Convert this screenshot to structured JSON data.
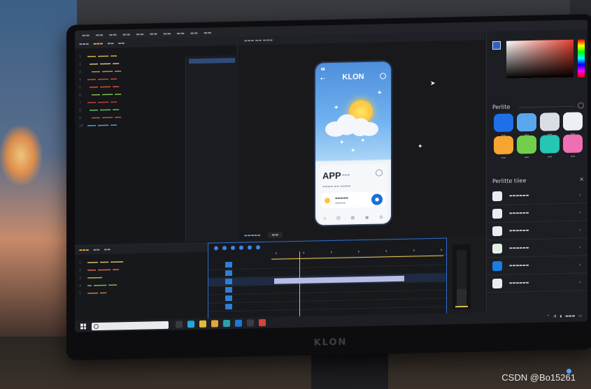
{
  "watermark": "CSDN @Bo15261",
  "monitor_brand": "KLON",
  "phone": {
    "title": "KLON",
    "card_title": "APP"
  },
  "palette": {
    "title": "Perlite",
    "swatches": [
      {
        "color": "#1f6fe8"
      },
      {
        "color": "#59a8ee"
      },
      {
        "color": "#d9dee6"
      },
      {
        "color": "#eceff3"
      },
      {
        "color": "#f7a531"
      },
      {
        "color": "#71cf4b"
      },
      {
        "color": "#25c6b4"
      },
      {
        "color": "#ef6fb4"
      }
    ]
  },
  "colors": {
    "accent": "#2d7be5",
    "timeline_border": "#2d6fd0",
    "highlight_yellow": "#e3c24b"
  },
  "properties": {
    "title": "Perlitte tiiee",
    "items": [
      {
        "thumb": "#e9ecf2",
        "icon": "chevron-right-icon"
      },
      {
        "thumb": "#e9ecf2",
        "icon": "chevron-right-icon"
      },
      {
        "thumb": "#e9ecf2",
        "icon": "chevron-right-icon"
      },
      {
        "thumb": "#e2efe3",
        "icon": "chevron-right-icon"
      },
      {
        "thumb": "#1a7de2",
        "icon": "chevron-right-icon"
      },
      {
        "thumb": "#e9ecf2",
        "icon": "chevron-right-icon"
      }
    ]
  },
  "code_lines": [
    {
      "color": "#e1b54c",
      "right": ""
    },
    {
      "color": "#e9c27a",
      "right": ""
    },
    {
      "color": "#c98f4f",
      "right": ""
    },
    {
      "color": "#d04a3c",
      "right": ""
    },
    {
      "color": "#e2523a",
      "right": ""
    },
    {
      "color": "#8ac24f",
      "right": ""
    },
    {
      "color": "#c0453a",
      "right": ""
    },
    {
      "color": "#6cc06a",
      "right": ""
    },
    {
      "color": "#c45a3d",
      "right": ""
    },
    {
      "color": "#5aa3d6",
      "right": ""
    }
  ]
}
